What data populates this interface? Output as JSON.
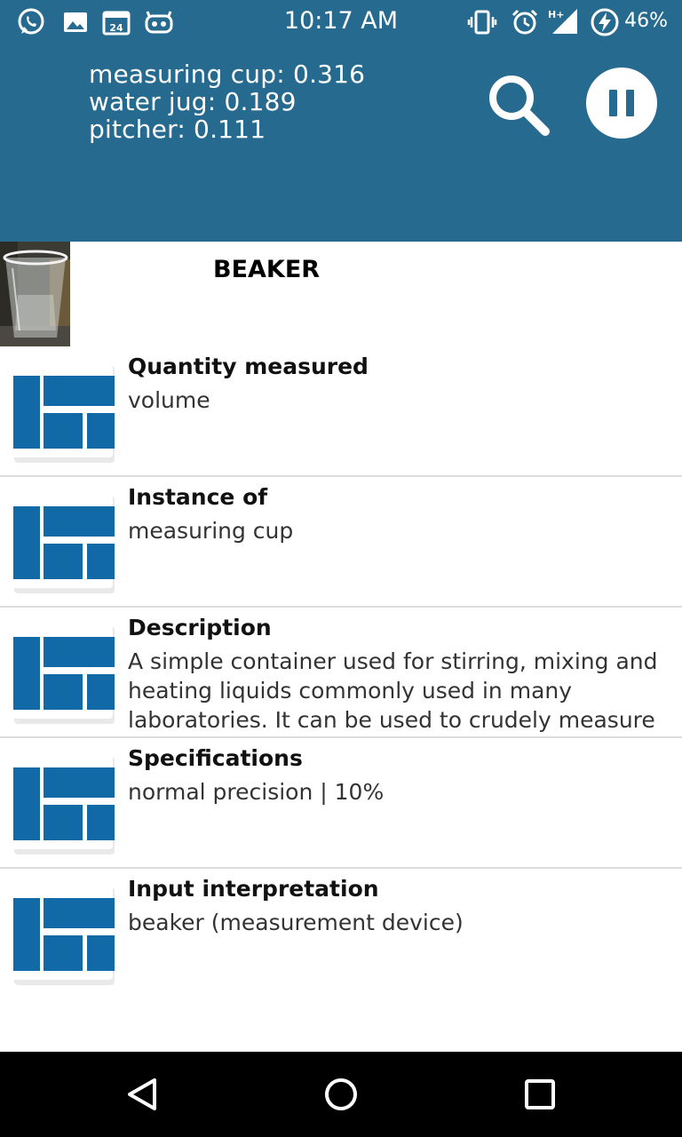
{
  "status_bar": {
    "time": "10:17 AM",
    "battery": "46%",
    "left_icons": [
      "whatsapp-icon",
      "gallery-icon",
      "calendar-icon",
      "cyanogen-icon"
    ],
    "right_icons": [
      "vibrate-icon",
      "alarm-icon",
      "signal-h-plus-icon",
      "battery-charging-icon"
    ],
    "calendar_day": "24",
    "network_label": "H+"
  },
  "header": {
    "predictions": [
      "measuring cup: 0.316",
      "water jug: 0.189",
      "pitcher: 0.111"
    ],
    "background_color": "#266b8f"
  },
  "result": {
    "title": "BEAKER"
  },
  "rows": [
    {
      "label": "Quantity measured",
      "value": "volume"
    },
    {
      "label": "Instance of",
      "value": "measuring cup"
    },
    {
      "label": "Description",
      "value": "A simple container used for stirring, mixing and heating liquids commonly used in many laboratories. It can be used to crudely measure"
    },
    {
      "label": "Specifications",
      "value": "normal precision | 10%"
    },
    {
      "label": "Input interpretation",
      "value": "beaker (measurement device)"
    }
  ],
  "nav_bar": {
    "buttons": [
      "back-icon",
      "home-icon",
      "recents-icon"
    ]
  }
}
